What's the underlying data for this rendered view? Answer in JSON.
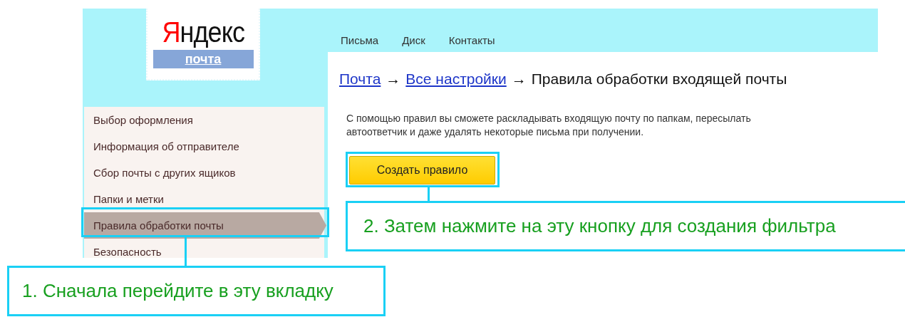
{
  "logo": {
    "text": "Яндекс",
    "service": "почта"
  },
  "nav": [
    {
      "label": "Письма"
    },
    {
      "label": "Диск"
    },
    {
      "label": "Контакты"
    }
  ],
  "sidebar": {
    "items": [
      {
        "label": "Выбор оформления",
        "selected": false
      },
      {
        "label": "Информация об отправителе",
        "selected": false
      },
      {
        "label": "Сбор почты с других ящиков",
        "selected": false
      },
      {
        "label": "Папки и метки",
        "selected": false
      },
      {
        "label": "Правила обработки почты",
        "selected": true
      },
      {
        "label": "Безопасность",
        "selected": false
      }
    ]
  },
  "breadcrumb": {
    "links": [
      "Почта",
      "Все настройки"
    ],
    "separator": "→",
    "current": "Правила обработки входящей почты"
  },
  "description": [
    "С помощью правил вы сможете раскладывать входящую почту по папкам, пересылать",
    "автоответчик и даже удалять некоторые письма при получении."
  ],
  "create_button": "Создать правило",
  "annotations": [
    {
      "text": "1. Сначала перейдите в эту вкладку"
    },
    {
      "text": "2. Затем нажмите на эту кнопку для создания фильтра"
    }
  ]
}
